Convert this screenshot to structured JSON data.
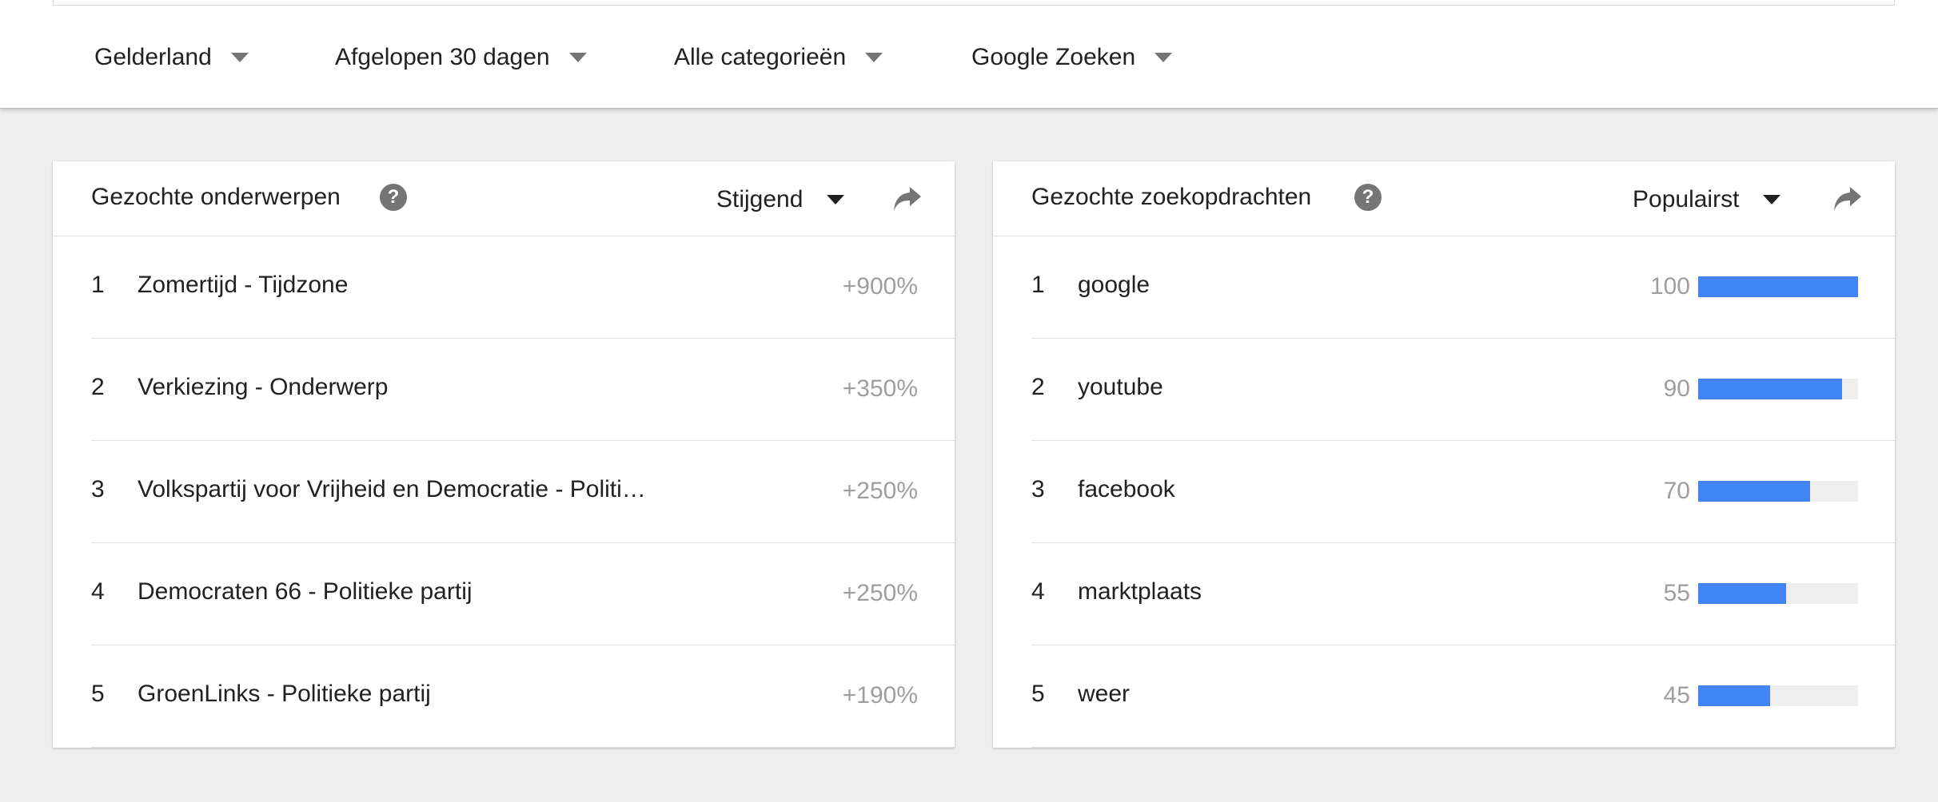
{
  "filters": [
    {
      "label": "Gelderland"
    },
    {
      "label": "Afgelopen 30 dagen"
    },
    {
      "label": "Alle categorieën"
    },
    {
      "label": "Google Zoeken"
    }
  ],
  "topics": {
    "title": "Gezochte onderwerpen",
    "sort": "Stijgend",
    "rows": [
      {
        "rank": "1",
        "label": "Zomertijd - Tijdzone",
        "value": "+900%"
      },
      {
        "rank": "2",
        "label": "Verkiezing - Onderwerp",
        "value": "+350%"
      },
      {
        "rank": "3",
        "label": "Volkspartij voor Vrijheid en Democratie - Politi…",
        "value": "+250%"
      },
      {
        "rank": "4",
        "label": "Democraten 66 - Politieke partij",
        "value": "+250%"
      },
      {
        "rank": "5",
        "label": "GroenLinks - Politieke partij",
        "value": "+190%"
      }
    ]
  },
  "queries": {
    "title": "Gezochte zoekopdrachten",
    "sort": "Populairst",
    "rows": [
      {
        "rank": "1",
        "label": "google",
        "value": "100",
        "level": 100
      },
      {
        "rank": "2",
        "label": "youtube",
        "value": "90",
        "level": 90
      },
      {
        "rank": "3",
        "label": "facebook",
        "value": "70",
        "level": 70
      },
      {
        "rank": "4",
        "label": "marktplaats",
        "value": "55",
        "level": 55
      },
      {
        "rank": "5",
        "label": "weer",
        "value": "45",
        "level": 45
      }
    ]
  },
  "icons": {
    "help": "help-icon",
    "share": "share-icon",
    "dropdown": "chevron-down-icon"
  },
  "colors": {
    "bar": "#4285f4",
    "bar_track": "#eeeeee",
    "background": "#eeeeee",
    "muted_text": "#9e9e9e"
  }
}
